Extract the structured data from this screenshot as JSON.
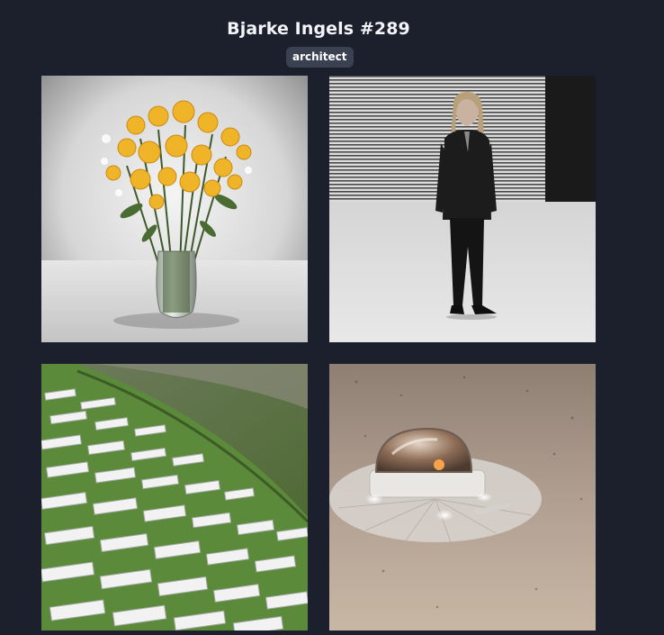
{
  "header": {
    "title": "Bjarke Ingels #289",
    "tag": "architect"
  },
  "gallery": {
    "images": [
      {
        "subject": "flower-bouquet-in-glass-vase"
      },
      {
        "subject": "black-and-white-portrait-of-woman"
      },
      {
        "subject": "aerial-view-of-white-buildings-on-green-hillside"
      },
      {
        "subject": "domed-structure-on-sandy-desert"
      }
    ]
  },
  "colors": {
    "background": "#1b202c",
    "tag_background": "#3a4150",
    "flower_yellow": "#f0b428",
    "desert_sand": "#b09f91"
  }
}
